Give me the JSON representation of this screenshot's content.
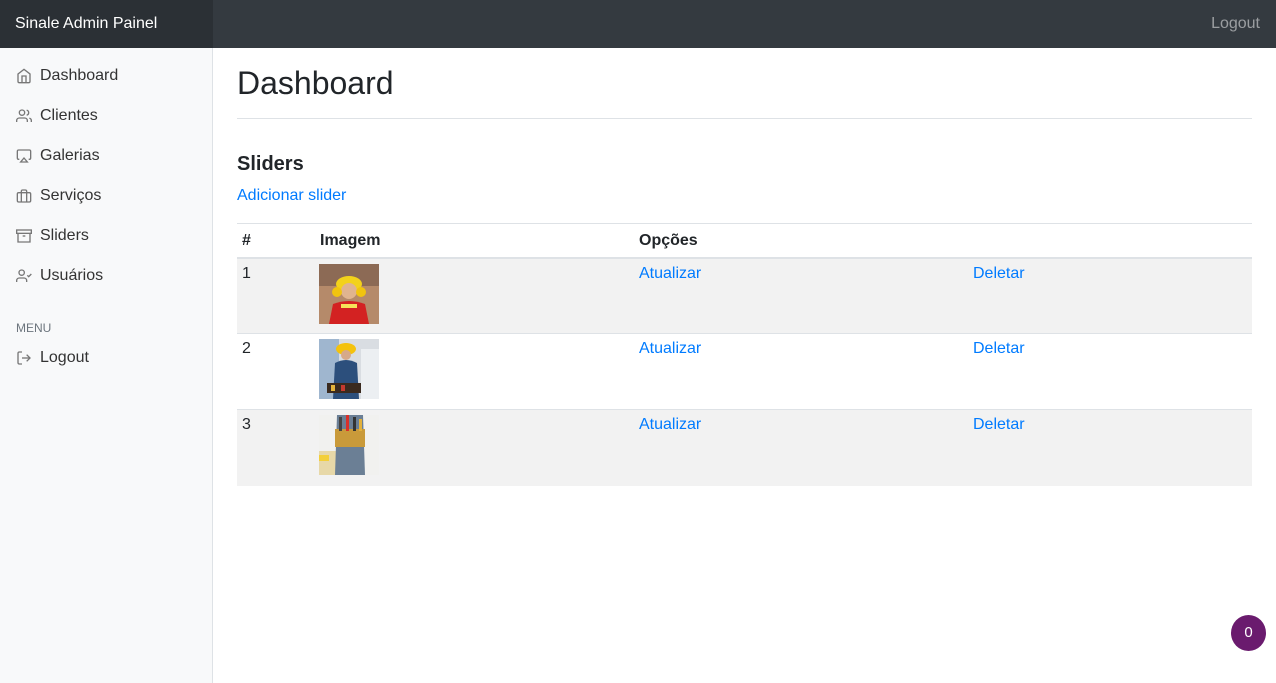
{
  "navbar": {
    "brand": "Sinale Admin Painel",
    "logout": "Logout"
  },
  "sidebar": {
    "items": [
      {
        "label": "Dashboard",
        "icon": "home-icon"
      },
      {
        "label": "Clientes",
        "icon": "users-icon"
      },
      {
        "label": "Galerias",
        "icon": "airplay-icon"
      },
      {
        "label": "Serviços",
        "icon": "briefcase-icon"
      },
      {
        "label": "Sliders",
        "icon": "archive-icon"
      },
      {
        "label": "Usuários",
        "icon": "user-check-icon"
      }
    ],
    "menu_heading": "MENU",
    "menu_items": [
      {
        "label": "Logout",
        "icon": "log-out-icon"
      }
    ]
  },
  "main": {
    "title": "Dashboard",
    "section_title": "Sliders",
    "add_link": "Adicionar slider",
    "table": {
      "headers": [
        "#",
        "Imagem",
        "Opções",
        ""
      ],
      "rows": [
        {
          "id": "1",
          "update": "Atualizar",
          "delete": "Deletar"
        },
        {
          "id": "2",
          "update": "Atualizar",
          "delete": "Deletar"
        },
        {
          "id": "3",
          "update": "Atualizar",
          "delete": "Deletar"
        }
      ]
    }
  },
  "badge": {
    "count": "0"
  },
  "colors": {
    "navbar": "#343a40",
    "brand_bg": "#2b3035",
    "link": "#007bff",
    "badge": "#6a1b6e"
  }
}
